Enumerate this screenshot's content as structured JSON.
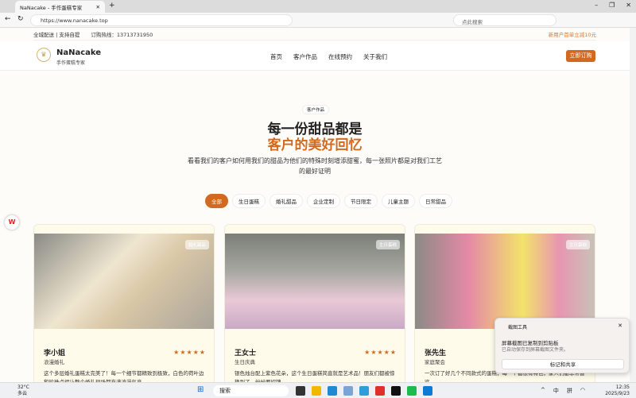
{
  "browser": {
    "tab_title": "NaNacake - 手作蛋糕专家",
    "url": "https://www.nanacake.top",
    "search_placeholder": "点此搜索"
  },
  "topbar": {
    "delivery": "全城配送 | 支持自提",
    "hotline": "订购热线：13713731950",
    "promo": "新用户首单立减10元"
  },
  "nav": {
    "brand": "NaNacake",
    "tagline": "手作蛋糕专家",
    "items": [
      "首页",
      "客户作品",
      "在线预约",
      "关于我们"
    ],
    "order_button": "立即订购"
  },
  "hero": {
    "pill": "客户作品",
    "title_line1": "每一份甜品都是",
    "title_line2": "客户的美好回忆",
    "description": "看看我们的客户如何用我们的甜品为他们的特殊时刻增添甜蜜，每一张照片都是对我们工艺的最好证明"
  },
  "filters": [
    "全部",
    "生日蛋糕",
    "婚礼甜品",
    "企业定制",
    "节日限定",
    "儿童主题",
    "日常甜品"
  ],
  "cards": [
    {
      "badge": "婚礼甜品",
      "name": "李小姐",
      "tag": "浪漫婚礼",
      "stars": "★★★★★",
      "text": "这个多层婚礼蛋糕太完美了！每一个细节都精致到极致，白色的荷叶边和珍珠点缀让整个婚礼现场都充满浪漫气息。"
    },
    {
      "badge": "生日蛋糕",
      "name": "王女士",
      "tag": "生日庆典",
      "stars": "★★★★★",
      "text": "银色烛台配上紫色花朵，这个生日蛋糕简直就是艺术品！朋友们都被惊艳到了，纷纷要招牌。"
    },
    {
      "badge": "生日蛋糕",
      "name": "张先生",
      "tag": "家庭聚会",
      "stars": "★★★★★",
      "text": "一次订了好几个不同款式的蛋糕，每一个都很有特色，家人们都非常喜欢。"
    }
  ],
  "toast": {
    "app": "截图工具",
    "line1": "屏幕截图已复制到剪贴板",
    "line2": "已自动保存到屏幕截图文件夹。",
    "button": "标记和共享"
  },
  "taskbar": {
    "temp": "32°C",
    "weather": "多云",
    "search": "搜索",
    "ime1": "中",
    "ime2": "拼",
    "time": "12:35",
    "date": "2025/9/23"
  }
}
